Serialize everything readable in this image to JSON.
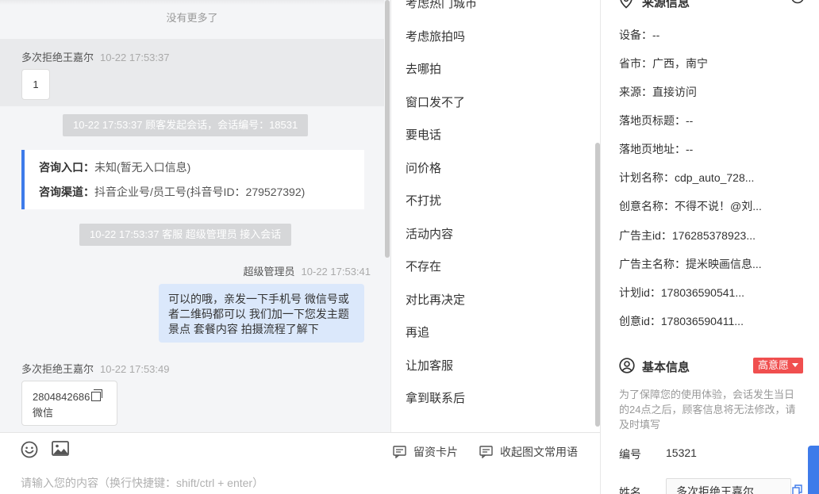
{
  "chat": {
    "no_more": "没有更多了",
    "messages": [
      {
        "sender": "多次拒绝王嘉尔",
        "time": "10-22 17:53:37",
        "text": "1"
      },
      {
        "sender": "多次拒绝王嘉尔",
        "time": "10-22 17:53:49",
        "card_number": "2804842686",
        "card_label": "微信"
      }
    ],
    "system_session_start": "10-22 17:53:37 顾客发起会话，会话编号：18531",
    "source": {
      "entry_label": "咨询入口：",
      "entry_value": "未知(暂无入口信息)",
      "channel_label": "咨询渠道：",
      "channel_value": "抖音企业号/员工号(抖音号ID：279527392)"
    },
    "system_join": "10-22 17:53:37 客服 超级管理员 接入会话",
    "agent": {
      "name": "超级管理员",
      "time": "10-22 17:53:41",
      "text": "可以的哦，亲发一下手机号 微信号或者二维码都可以 我们加一下您发主题景点 套餐内容 拍摄流程了解下"
    }
  },
  "input": {
    "placeholder": "请输入您的内容（换行快捷键：shift/ctrl + enter）",
    "lead_card_label": "留资卡片",
    "collapse_phrases_label": "收起图文常用语"
  },
  "phrases": {
    "items": [
      "考虑热门城市",
      "考虑旅拍吗",
      "去哪拍",
      "窗口发不了",
      "要电话",
      "问价格",
      "不打扰",
      "活动内容",
      "不存在",
      "对比再决定",
      "再追",
      "让加客服",
      "拿到联系后"
    ]
  },
  "info": {
    "source_title": "来源信息",
    "source_rows": [
      "设备：--",
      "省市：广西，南宁",
      "来源：直接访问",
      "落地页标题：--",
      "落地页地址：--",
      "计划名称：cdp_auto_728...",
      "创意名称：不得不说！@刘...",
      "广告主id：176285378923...",
      "广告主名称：提米映画信息...",
      "计划id：178036590541...",
      "创意id：178036590411..."
    ],
    "basic_title": "基本信息",
    "intent": "高意愿",
    "notice": "为了保障您的使用体验，会话发生当日的24点之后，顾客信息将无法修改，请及时填写",
    "number_label": "编号",
    "number_value": "15321",
    "name_label": "姓名",
    "name_value": "多次拒绝王嘉尔"
  },
  "colors": {
    "accent": "#3e7bea",
    "agent_bubble": "#dbe8fb",
    "intent_badge": "#f04f4f"
  }
}
